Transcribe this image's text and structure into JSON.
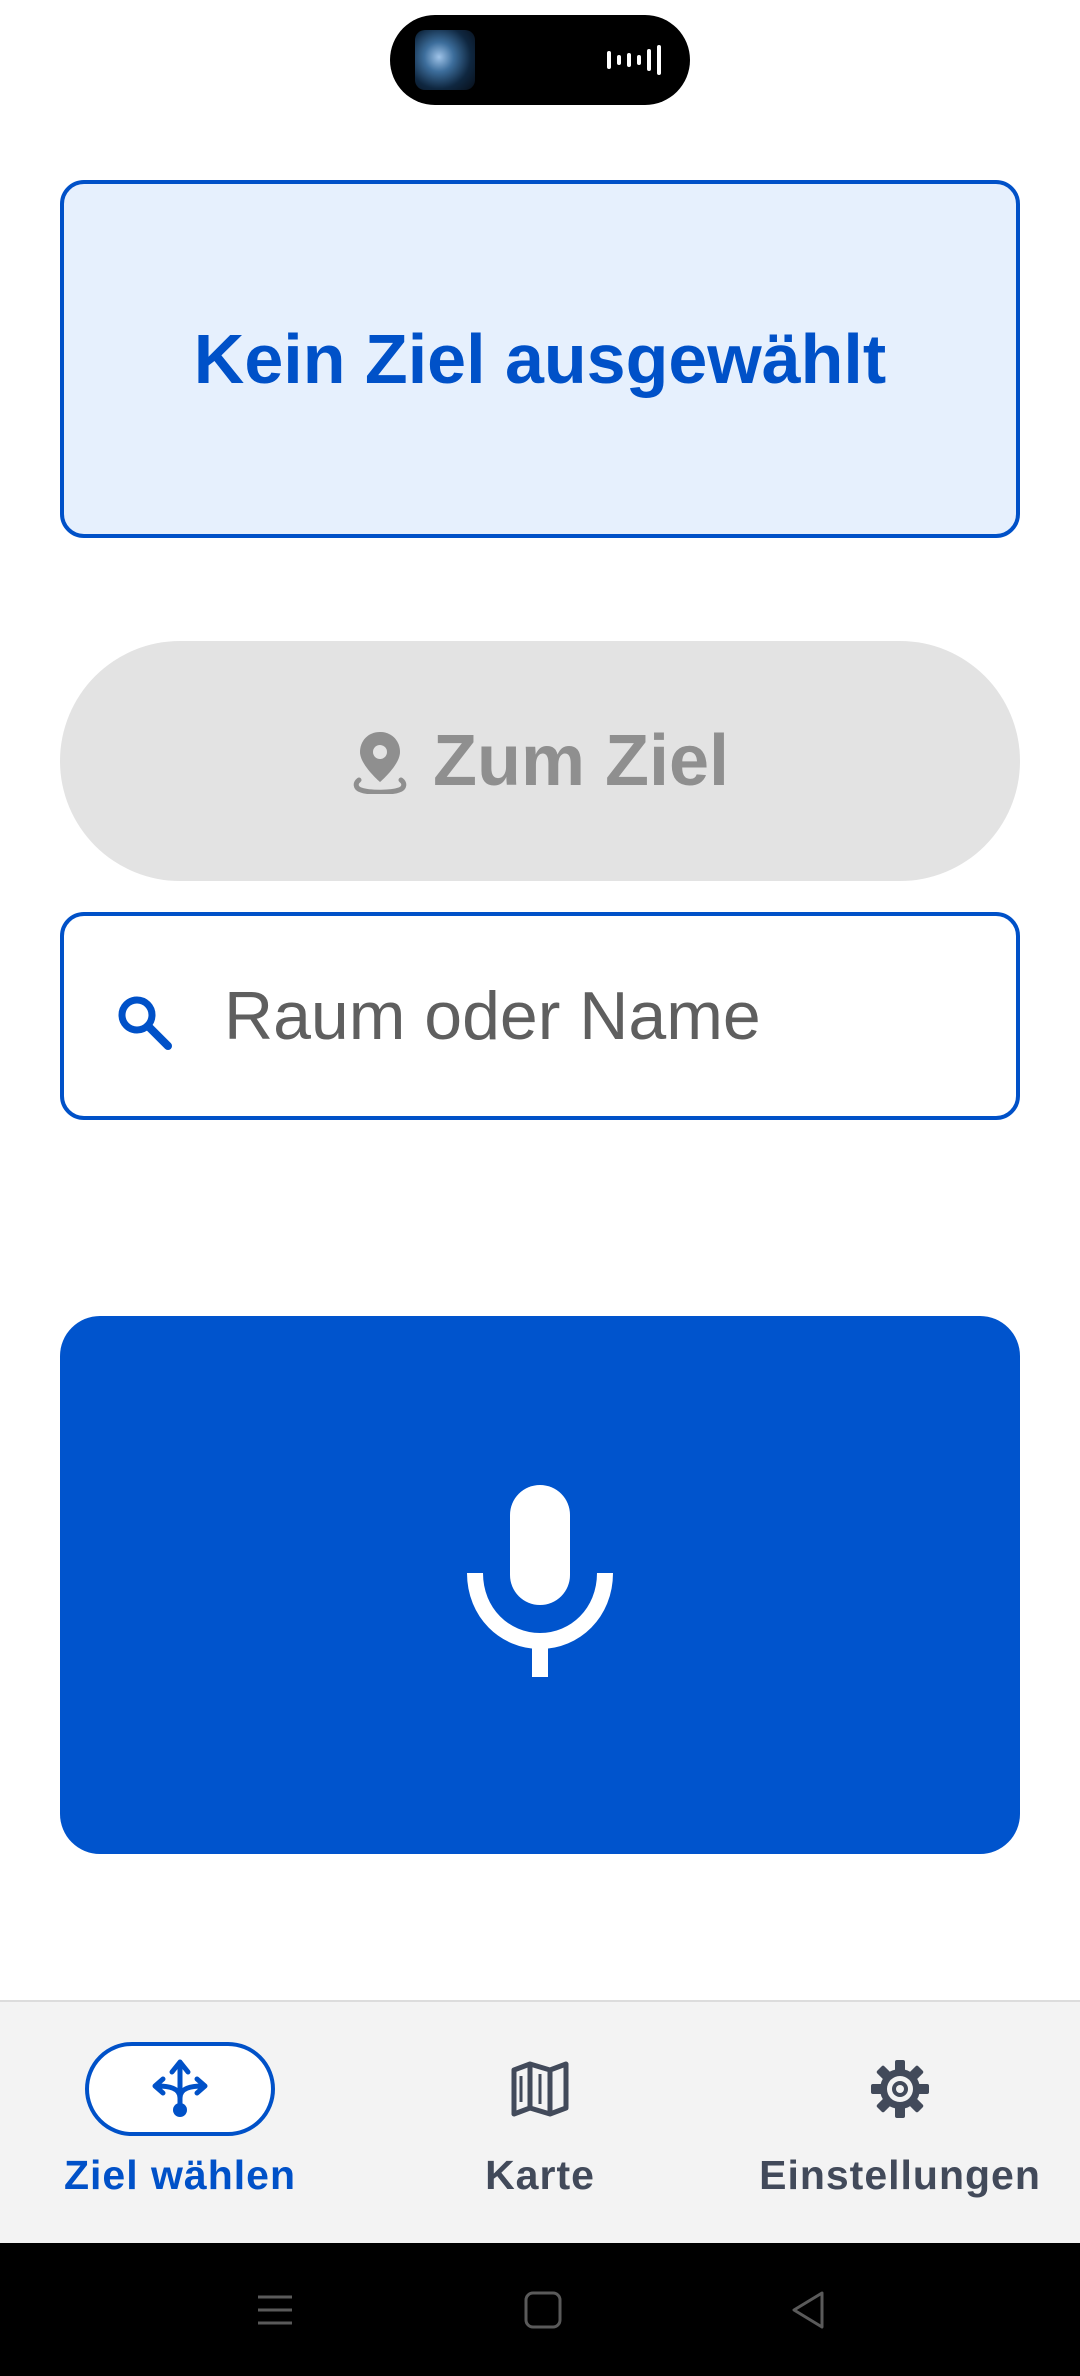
{
  "destination": {
    "status_text": "Kein Ziel ausgewählt"
  },
  "goto_button": {
    "label": "Zum Ziel",
    "icon": "location-pin-icon",
    "enabled": false
  },
  "search": {
    "placeholder": "Raum oder Name",
    "value": "",
    "icon": "search-icon"
  },
  "voice_button": {
    "icon": "microphone-icon"
  },
  "bottom_nav": {
    "items": [
      {
        "label": "Ziel wählen",
        "icon": "directions-fork-icon",
        "active": true
      },
      {
        "label": "Karte",
        "icon": "map-icon",
        "active": false
      },
      {
        "label": "Einstellungen",
        "icon": "gear-icon",
        "active": false
      }
    ]
  },
  "colors": {
    "primary": "#0051c8",
    "card_background": "#e6f0fd",
    "disabled_background": "#e3e3e3",
    "disabled_text": "#8f8f8f",
    "nav_background": "#f3f3f3",
    "nav_text": "#424a5a"
  }
}
